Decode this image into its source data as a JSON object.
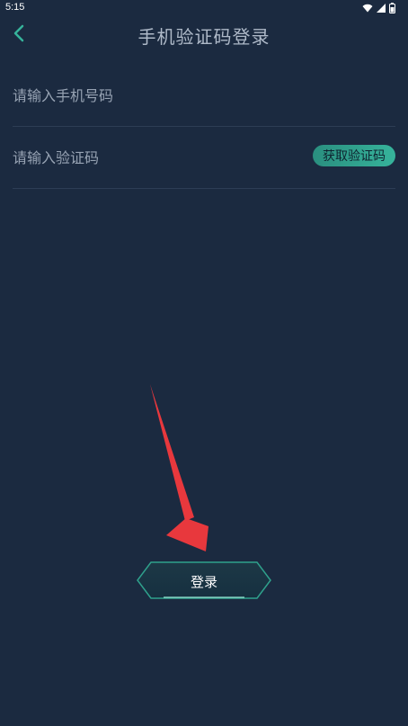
{
  "status_bar": {
    "time": "5:15",
    "icons": [
      "wifi-icon",
      "signal-icon",
      "battery-icon"
    ]
  },
  "header": {
    "back_icon": "chevron-left-icon",
    "title": "手机验证码登录"
  },
  "form": {
    "phone": {
      "placeholder": "请输入手机号码",
      "value": ""
    },
    "code": {
      "placeholder": "请输入验证码",
      "value": "",
      "get_code_label": "获取验证码"
    }
  },
  "login_button": {
    "label": "登录"
  },
  "colors": {
    "background": "#1b2a40",
    "accent": "#36b39b",
    "arrow": "#e8383d"
  }
}
